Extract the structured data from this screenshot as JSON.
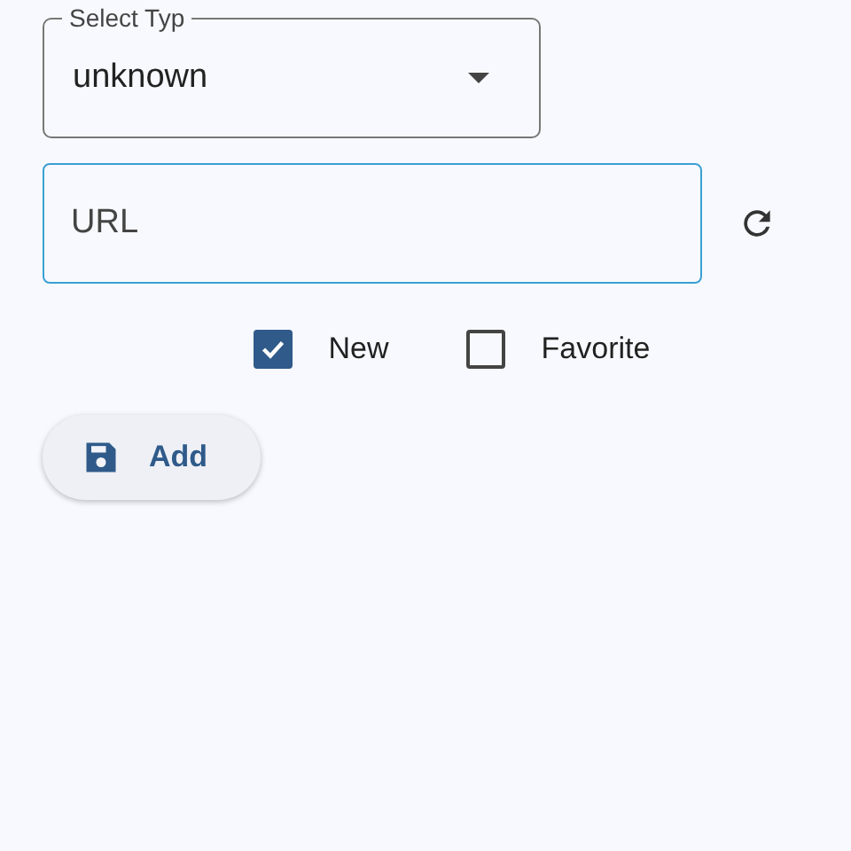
{
  "select": {
    "label": "Select Typ",
    "value": "unknown"
  },
  "url_field": {
    "placeholder": "URL"
  },
  "checkboxes": [
    {
      "label": "New",
      "checked": true
    },
    {
      "label": "Favorite",
      "checked": false
    }
  ],
  "add_button": {
    "label": "Add"
  }
}
